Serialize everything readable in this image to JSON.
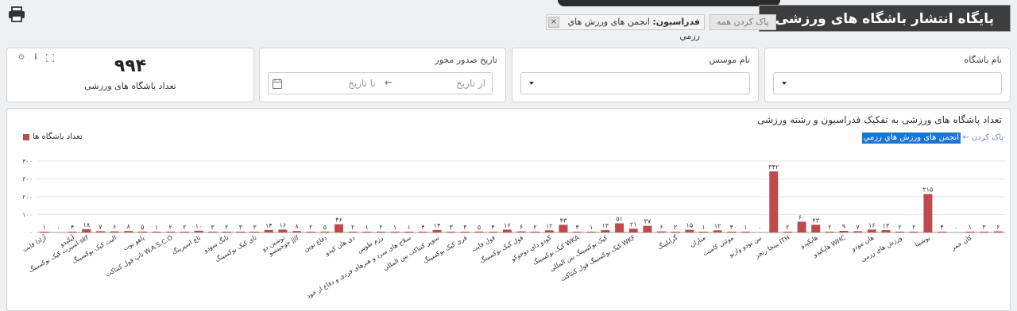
{
  "app": {
    "title": "پایگاه انتشار باشگاه های ورزشی"
  },
  "icons": {
    "print": "print-icon",
    "settings": "gear-icon",
    "info": "info-icon",
    "expand": "expand-icon",
    "calendar": "calendar-icon"
  },
  "filters": {
    "clear_all_label": "پاک کردن همه",
    "chip_key": "فدراسیون:",
    "chip_value": "انجمن های ورزش هاي رزمي",
    "chip_close": "×"
  },
  "cards": {
    "club_name": {
      "label": "نام باشگاه"
    },
    "founder_name": {
      "label": "نام موسس"
    },
    "license_date": {
      "label": "تاریخ صدور مجوز",
      "from_placeholder": "از تاریخ",
      "arrow": "←",
      "to_placeholder": "تا تاریخ"
    },
    "kpi": {
      "value": "۹۹۴",
      "label": "تعداد باشگاه های ورزشی"
    }
  },
  "chart_header": {
    "title": "تعداد باشگاه های ورزشی به تفکیک فدراسیون و رشته ورزشی",
    "legend_label": "تعداد باشگاه ها",
    "drill_selected": "انجمن های ورزش هاي رزمي",
    "drill_clear": "پاک کردن ←"
  },
  "colors": {
    "bar": "#c0494e",
    "selection": "#1976d2"
  },
  "chart_data": {
    "type": "bar",
    "ylim": [
      0,
      400
    ],
    "yticks": [
      "۰",
      "۱۰۰",
      "۲۰۰",
      "۳۰۰",
      "۴۰۰"
    ],
    "grid": true,
    "legend": "top-left",
    "series": [
      {
        "name": "تعداد باشگاه ها"
      }
    ],
    "categories": [
      "آزادا فایت",
      "",
      "آیکیدو",
      "اسپرت کیک بوکسینگ skf",
      "",
      "الیت کیک بوکسینگ",
      "",
      "پاهو بوت",
      "",
      "تاپ فول کنتاکت W.A.S.C.O",
      "",
      "تاچ اسپرینگ",
      "",
      "تانگ سودو",
      "",
      "تای کیک بوکسینگ",
      "",
      "توشین دو",
      "جوجیتسو jjif",
      "",
      "دفاع نوین",
      "",
      "دی هان کیدو",
      "",
      "رزم طوس",
      "",
      "سلاح های سرد و هنرهای فردی و دفاع از خود",
      "",
      "سوپر کنتاکت بین المللی",
      "",
      "فری کیک بوکسینگ",
      "",
      "فول فایت",
      "",
      "فول کیک بوکسینگ",
      "",
      "کودو دای دوجوکو",
      "",
      "کیک بوکسینگ WKA",
      "",
      "کیک بوکسینگ بین المللی",
      "",
      "کیک بوکسینگ فول کنتاکت WKF",
      "",
      "",
      "گراپلینگ",
      "",
      "مباران",
      "",
      "موئتی کامبت",
      "",
      "نین بودو وازیو",
      "",
      "نینجا رنجر ITH",
      "",
      "هاپکیدو",
      "",
      "هاپکیدو WHC",
      "",
      "هان مودو",
      "",
      "ورزش های رزمی",
      "",
      "یوشیتا",
      "",
      "",
      "کان خمر"
    ],
    "values": [
      1,
      0,
      4,
      18,
      7,
      6,
      8,
      5,
      1,
      2,
      2,
      10,
      3,
      2,
      3,
      3,
      14,
      16,
      8,
      2,
      5,
      46,
      2,
      1,
      2,
      1,
      1,
      4,
      14,
      3,
      3,
      5,
      4,
      16,
      6,
      2,
      12,
      43,
      4,
      1,
      13,
      51,
      21,
      37,
      6,
      2,
      15,
      1,
      12,
      4,
      1,
      0,
      342,
      2,
      60,
      43,
      2,
      9,
      7,
      16,
      13,
      2,
      2,
      215,
      4,
      0,
      1,
      3,
      6
    ],
    "data_labels": [
      "۱",
      "۰",
      "۴",
      "۱۸",
      "۷",
      "۶",
      "۸",
      "۵",
      "۱",
      "۲",
      "۲",
      "۱۰",
      "۳",
      "۲",
      "۳",
      "۳",
      "۱۴",
      "۱۶",
      "۸",
      "۲",
      "۵",
      "۴۶",
      "۲",
      "۱",
      "۲",
      "۱",
      "۱",
      "۴",
      "۱۴",
      "۳",
      "۳",
      "۵",
      "۴",
      "۱۶",
      "۶",
      "۲",
      "۱۲",
      "۴۳",
      "۴",
      "۱",
      "۱۳",
      "۵۱",
      "۲۱",
      "۳۷",
      "۶",
      "۲",
      "۱۵",
      "۱",
      "۱۲",
      "۴",
      "۱",
      "۰",
      "۳۴۲",
      "۲",
      "۶۰",
      "۴۳",
      "۲",
      "۹",
      "۷",
      "۱۶",
      "۱۳",
      "۲",
      "۲",
      "۲۱۵",
      "۴",
      "۰",
      "۱",
      "۳",
      "۶"
    ]
  }
}
